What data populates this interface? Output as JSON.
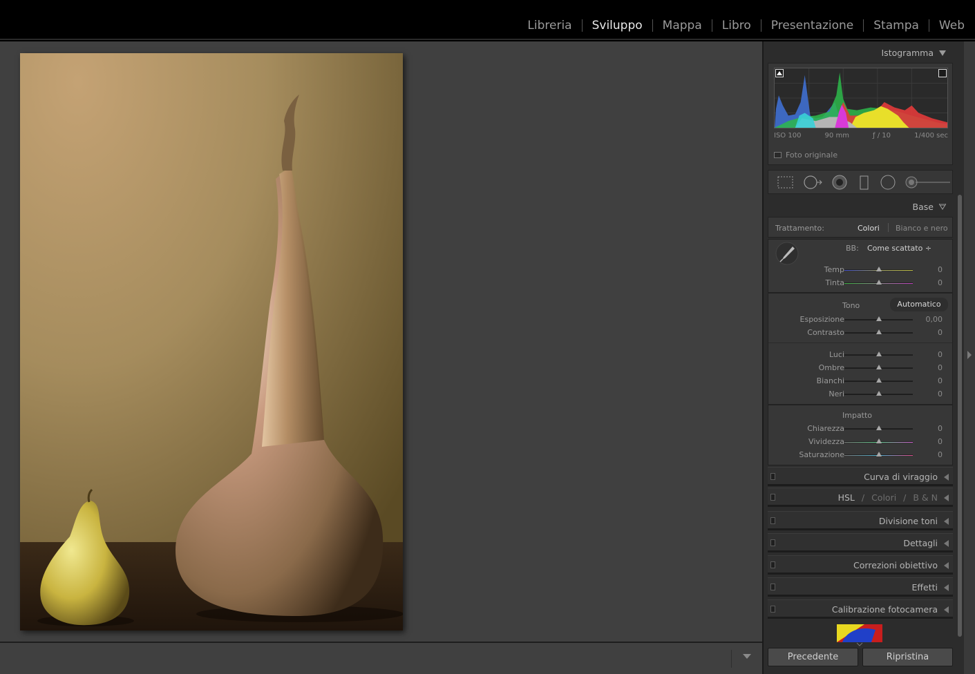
{
  "modules": [
    {
      "label": "Libreria",
      "active": false
    },
    {
      "label": "Sviluppo",
      "active": true
    },
    {
      "label": "Mappa",
      "active": false
    },
    {
      "label": "Libro",
      "active": false
    },
    {
      "label": "Presentazione",
      "active": false
    },
    {
      "label": "Stampa",
      "active": false
    },
    {
      "label": "Web",
      "active": false
    }
  ],
  "histogram": {
    "title": "Istogramma",
    "iso": "ISO 100",
    "focal": "90 mm",
    "aperture": "ƒ / 10",
    "shutter": "1/400 sec",
    "original_label": "Foto originale"
  },
  "base": {
    "title": "Base",
    "treatment_label": "Trattamento:",
    "treatment_color": "Colori",
    "treatment_bw": "Bianco e nero",
    "wb_label": "BB:",
    "wb_value": "Come scattato ÷",
    "tone_label": "Tono",
    "auto_label": "Automatico",
    "presence_label": "Impatto",
    "sliders": {
      "temp": {
        "label": "Temp",
        "value": "0",
        "pos": 0.5
      },
      "tint": {
        "label": "Tinta",
        "value": "0",
        "pos": 0.5
      },
      "exposure": {
        "label": "Esposizione",
        "value": "0,00",
        "pos": 0.5
      },
      "contrast": {
        "label": "Contrasto",
        "value": "0",
        "pos": 0.5
      },
      "highlights": {
        "label": "Luci",
        "value": "0",
        "pos": 0.5
      },
      "shadows": {
        "label": "Ombre",
        "value": "0",
        "pos": 0.5
      },
      "whites": {
        "label": "Bianchi",
        "value": "0",
        "pos": 0.5
      },
      "blacks": {
        "label": "Neri",
        "value": "0",
        "pos": 0.5
      },
      "clarity": {
        "label": "Chiarezza",
        "value": "0",
        "pos": 0.5
      },
      "vibrance": {
        "label": "Vividezza",
        "value": "0",
        "pos": 0.5
      },
      "saturation": {
        "label": "Saturazione",
        "value": "0",
        "pos": 0.5
      }
    }
  },
  "panels": {
    "tone_curve": "Curva di viraggio",
    "hsl": "HSL",
    "hsl_color": "Colori",
    "hsl_bw": "B & N",
    "hsl_sep": "/",
    "split": "Divisione toni",
    "detail": "Dettagli",
    "lens": "Correzioni obiettivo",
    "effects": "Effetti",
    "calibration": "Calibrazione fotocamera"
  },
  "buttons": {
    "previous": "Precedente",
    "reset": "Ripristina"
  },
  "colors": {
    "accent_active": "#e8e8e8",
    "panel_bg": "#2c2c2c",
    "canvas_bg": "#404040"
  }
}
